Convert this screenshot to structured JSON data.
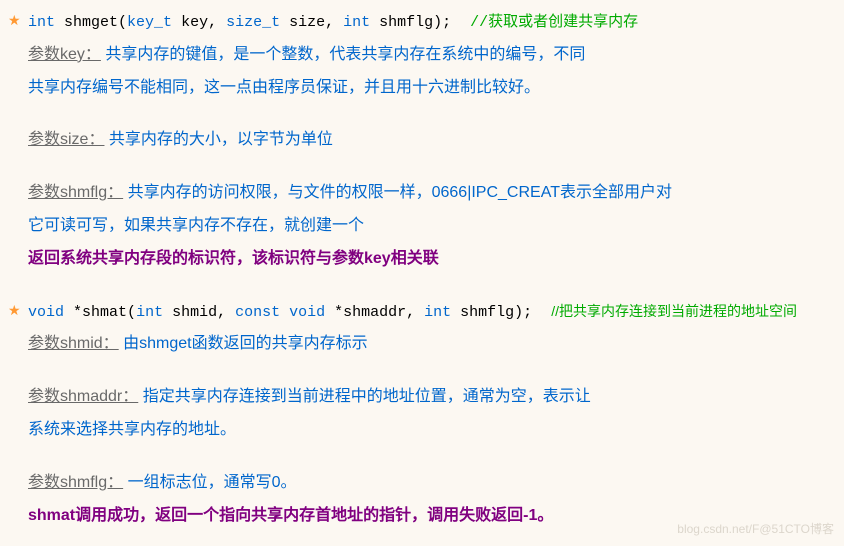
{
  "sec1": {
    "sig_type1": "int",
    "sig_func": " shmget",
    "sig_paren": "(",
    "sig_arg1t": "key_t",
    "sig_arg1n": " key, ",
    "sig_arg2t": "size_t",
    "sig_arg2n": " size, ",
    "sig_arg3t": "int",
    "sig_arg3n": " shmflg",
    "sig_close": ");",
    "comment": "//获取或者创建共享内存",
    "p_key_label": "参数key：",
    "p_key_desc1": "共享内存的键值，是一个整数，代表共享内存在系统中的编号，不同",
    "p_key_desc2": "共享内存编号不能相同，这一点由程序员保证，并且用十六进制比较好。",
    "p_size_label": "参数size：",
    "p_size_desc": "共享内存的大小，以字节为单位",
    "p_flg_label": "参数shmflg：",
    "p_flg_desc1a": "共享内存的访问权限，与文件的权限一样，",
    "p_flg_desc1b": "0666|IPC_CREAT",
    "p_flg_desc1c": "表示全部用户对",
    "p_flg_desc2": "它可读可写，如果共享内存不存在，就创建一个",
    "ret": "返回系统共享内存段的标识符，该标识符与参数key相关联"
  },
  "sec2": {
    "sig_type1": "void",
    "sig_ptr": " *",
    "sig_func": "shmat",
    "sig_paren": "(",
    "sig_arg1t": "int",
    "sig_arg1n": " shmid, ",
    "sig_arg2t": "const void",
    "sig_arg2n": " *shmaddr, ",
    "sig_arg3t": "int",
    "sig_arg3n": " shmflg",
    "sig_close": ");",
    "comment": "//把共享内存连接到当前进程的地址空间",
    "p_id_label": "参数shmid：",
    "p_id_desc": "由shmget函数返回的共享内存标示",
    "p_addr_label": "参数shmaddr：",
    "p_addr_desc1": "指定共享内存连接到当前进程中的地址位置，通常为空，表示让",
    "p_addr_desc2": "系统来选择共享内存的地址。",
    "p_flg_label": "参数shmflg：",
    "p_flg_desc": "一组标志位，通常写0。",
    "ret": "shmat调用成功，返回一个指向共享内存首地址的指针，调用失败返回-1。"
  },
  "watermark": "blog.csdn.net/F@51CTO博客"
}
